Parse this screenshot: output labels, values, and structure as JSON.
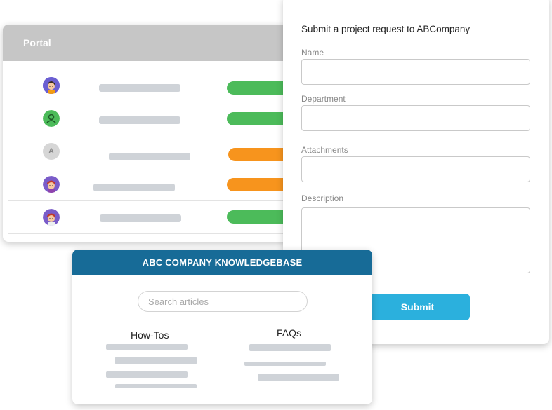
{
  "portal": {
    "title": "Portal",
    "rows": [
      {
        "avatar": "avatar-icon",
        "status_color": "#4cbb5a"
      },
      {
        "avatar": "person-icon",
        "status_color": "#4cbb5a"
      },
      {
        "avatar": "letter-avatar",
        "letter": "A",
        "status_color": "#f7941d"
      },
      {
        "avatar": "avatar-icon",
        "status_color": "#f7941d"
      },
      {
        "avatar": "avatar-icon",
        "status_color": "#4cbb5a"
      }
    ]
  },
  "form": {
    "title": "Submit a project request to ABCompany",
    "fields": {
      "name_label": "Name",
      "department_label": "Department",
      "attachments_label": "Attachments",
      "description_label": "Description"
    },
    "submit_label": "Submit"
  },
  "knowledgebase": {
    "title": "ABC COMPANY KNOWLEDGEBASE",
    "search_placeholder": "Search articles",
    "columns": [
      "How-Tos",
      "FAQs"
    ]
  },
  "colors": {
    "green": "#4cbb5a",
    "orange": "#f7941d",
    "header_blue": "#176b97",
    "button_blue": "#2bb0dd"
  }
}
